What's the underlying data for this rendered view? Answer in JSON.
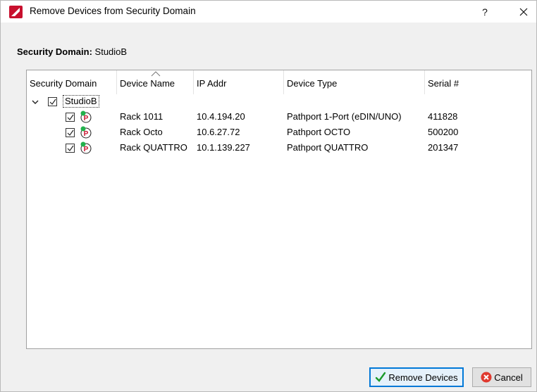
{
  "window": {
    "title": "Remove Devices from Security Domain",
    "help_label": "?",
    "brand_color": "#c8102e"
  },
  "domain_line": {
    "label": "Security Domain:",
    "value": "StudioB"
  },
  "table": {
    "columns": [
      "Security Domain",
      "Device Name",
      "IP Addr",
      "Device Type",
      "Serial #"
    ],
    "sorted_column": "Device Name",
    "domain": {
      "name": "StudioB",
      "expanded": true,
      "checked": true
    },
    "devices": [
      {
        "checked": true,
        "icon": "pathport-device-icon",
        "name": "Rack 1011",
        "ip": "10.4.194.20",
        "type": "Pathport 1-Port (eDIN/UNO)",
        "serial": "411828"
      },
      {
        "checked": true,
        "icon": "pathport-device-icon",
        "name": "Rack Octo",
        "ip": "10.6.27.72",
        "type": "Pathport OCTO",
        "serial": "500200"
      },
      {
        "checked": true,
        "icon": "pathport-device-icon",
        "name": "Rack QUATTRO",
        "ip": "10.1.139.227",
        "type": "Pathport QUATTRO",
        "serial": "201347"
      }
    ]
  },
  "buttons": {
    "remove_label": "Remove Devices",
    "cancel_label": "Cancel"
  }
}
